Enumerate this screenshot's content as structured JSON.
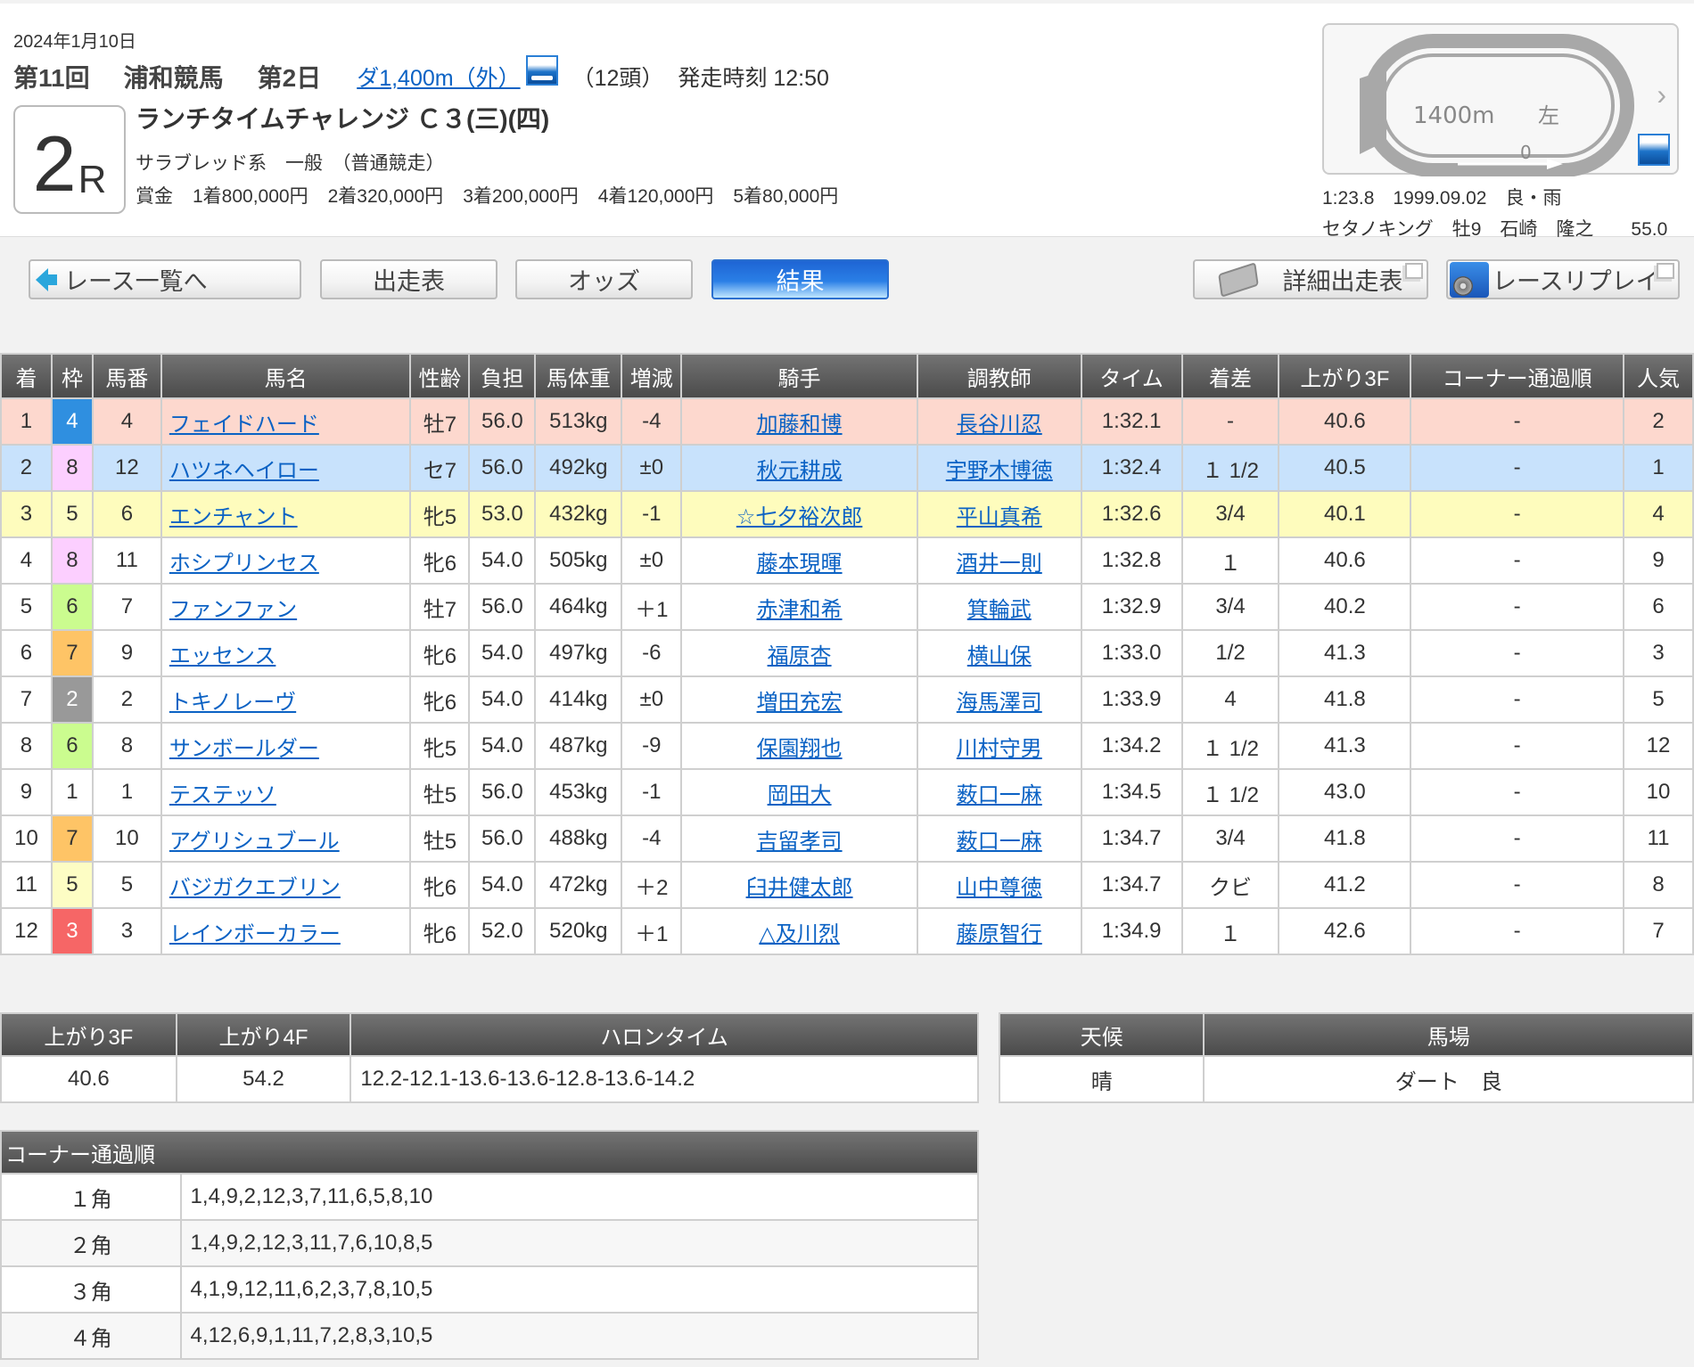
{
  "header": {
    "date": "2024年1月10日",
    "meeting": "第11回",
    "venue": "浦和競馬",
    "day": "第2日",
    "course_link": "ダ1,400m（外）",
    "runners": "（12頭）",
    "post_time": "発走時刻 12:50",
    "race_number": "2",
    "race_suffix": "R",
    "race_name": "ランチタイムチャレンジ Ｃ３(三)(四)",
    "conditions": "サラブレッド系　一般　（普通競走）",
    "prize_label": "賞金",
    "prizes": [
      "1着800,000円",
      "2着320,000円",
      "3着200,000円",
      "4着120,000円",
      "5着80,000円"
    ]
  },
  "course_map": {
    "distance_label": "1400m",
    "direction": "左",
    "start_marker": "0",
    "record_line1": "1:23.8　1999.09.02　良・雨",
    "record_line2": "セタノキング　牡9　石崎　隆之　　55.0"
  },
  "nav": {
    "back": "レース一覧へ",
    "entries": "出走表",
    "odds": "オッズ",
    "results": "結果",
    "detail_entries": "詳細出走表",
    "replay": "レースリプレイ"
  },
  "results": {
    "headers": [
      "着",
      "枠",
      "馬番",
      "馬名",
      "性齢",
      "負担",
      "馬体重",
      "増減",
      "騎手",
      "調教師",
      "タイム",
      "着差",
      "上がり3F",
      "コーナー通過順",
      "人気"
    ],
    "frame_colors": {
      "1": {
        "bg": "#ffffff",
        "fg": "#333333"
      },
      "2": {
        "bg": "#999999",
        "fg": "#ffffff"
      },
      "3": {
        "bg": "#f66666",
        "fg": "#ffffff"
      },
      "4": {
        "bg": "#2f8fe0",
        "fg": "#ffffff"
      },
      "5": {
        "bg": "#fdfdc4",
        "fg": "#333333"
      },
      "6": {
        "bg": "#cbfc8f",
        "fg": "#333333"
      },
      "7": {
        "bg": "#fec466",
        "fg": "#333333"
      },
      "8": {
        "bg": "#fccfff",
        "fg": "#333333"
      }
    },
    "rows": [
      {
        "pos": "1",
        "frame": "4",
        "num": "4",
        "horse": "フェイドハード",
        "sexage": "牡7",
        "weight": "56.0",
        "body": "513kg",
        "diff": "-4",
        "jockey": "加藤和博",
        "trainer": "長谷川忍",
        "time": "1:32.1",
        "margin": "-",
        "last3f": "40.6",
        "corner": "-",
        "pop": "2"
      },
      {
        "pos": "2",
        "frame": "8",
        "num": "12",
        "horse": "ハツネヘイロー",
        "sexage": "セ7",
        "weight": "56.0",
        "body": "492kg",
        "diff": "±0",
        "jockey": "秋元耕成",
        "trainer": "宇野木博徳",
        "time": "1:32.4",
        "margin": "１ 1/2",
        "last3f": "40.5",
        "corner": "-",
        "pop": "1"
      },
      {
        "pos": "3",
        "frame": "5",
        "num": "6",
        "horse": "エンチャント",
        "sexage": "牝5",
        "weight": "53.0",
        "body": "432kg",
        "diff": "-1",
        "jockey": "☆七夕裕次郎",
        "trainer": "平山真希",
        "time": "1:32.6",
        "margin": "3/4",
        "last3f": "40.1",
        "corner": "-",
        "pop": "4"
      },
      {
        "pos": "4",
        "frame": "8",
        "num": "11",
        "horse": "ホシプリンセス",
        "sexage": "牝6",
        "weight": "54.0",
        "body": "505kg",
        "diff": "±0",
        "jockey": "藤本現暉",
        "trainer": "酒井一則",
        "time": "1:32.8",
        "margin": "１",
        "last3f": "40.6",
        "corner": "-",
        "pop": "9"
      },
      {
        "pos": "5",
        "frame": "6",
        "num": "7",
        "horse": "ファンファン",
        "sexage": "牡7",
        "weight": "56.0",
        "body": "464kg",
        "diff": "＋1",
        "jockey": "赤津和希",
        "trainer": "箕輪武",
        "time": "1:32.9",
        "margin": "3/4",
        "last3f": "40.2",
        "corner": "-",
        "pop": "6"
      },
      {
        "pos": "6",
        "frame": "7",
        "num": "9",
        "horse": "エッセンス",
        "sexage": "牝6",
        "weight": "54.0",
        "body": "497kg",
        "diff": "-6",
        "jockey": "福原杏",
        "trainer": "横山保",
        "time": "1:33.0",
        "margin": "1/2",
        "last3f": "41.3",
        "corner": "-",
        "pop": "3"
      },
      {
        "pos": "7",
        "frame": "2",
        "num": "2",
        "horse": "トキノレーヴ",
        "sexage": "牝6",
        "weight": "54.0",
        "body": "414kg",
        "diff": "±0",
        "jockey": "増田充宏",
        "trainer": "海馬澤司",
        "time": "1:33.9",
        "margin": "4",
        "last3f": "41.8",
        "corner": "-",
        "pop": "5"
      },
      {
        "pos": "8",
        "frame": "6",
        "num": "8",
        "horse": "サンボールダー",
        "sexage": "牝5",
        "weight": "54.0",
        "body": "487kg",
        "diff": "-9",
        "jockey": "保園翔也",
        "trainer": "川村守男",
        "time": "1:34.2",
        "margin": "１ 1/2",
        "last3f": "41.3",
        "corner": "-",
        "pop": "12"
      },
      {
        "pos": "9",
        "frame": "1",
        "num": "1",
        "horse": "テステッソ",
        "sexage": "牡5",
        "weight": "56.0",
        "body": "453kg",
        "diff": "-1",
        "jockey": "岡田大",
        "trainer": "薮口一麻",
        "time": "1:34.5",
        "margin": "１ 1/2",
        "last3f": "43.0",
        "corner": "-",
        "pop": "10"
      },
      {
        "pos": "10",
        "frame": "7",
        "num": "10",
        "horse": "アグリシュブール",
        "sexage": "牡5",
        "weight": "56.0",
        "body": "488kg",
        "diff": "-4",
        "jockey": "吉留孝司",
        "trainer": "薮口一麻",
        "time": "1:34.7",
        "margin": "3/4",
        "last3f": "41.8",
        "corner": "-",
        "pop": "11"
      },
      {
        "pos": "11",
        "frame": "5",
        "num": "5",
        "horse": "バジガクエブリン",
        "sexage": "牝6",
        "weight": "54.0",
        "body": "472kg",
        "diff": "＋2",
        "jockey": "臼井健太郎",
        "trainer": "山中尊徳",
        "time": "1:34.7",
        "margin": "クビ",
        "last3f": "41.2",
        "corner": "-",
        "pop": "8"
      },
      {
        "pos": "12",
        "frame": "3",
        "num": "3",
        "horse": "レインボーカラー",
        "sexage": "牝6",
        "weight": "52.0",
        "body": "520kg",
        "diff": "＋1",
        "jockey": "△及川烈",
        "trainer": "藤原智行",
        "time": "1:34.9",
        "margin": "１",
        "last3f": "42.6",
        "corner": "-",
        "pop": "7"
      }
    ]
  },
  "laps": {
    "headers": [
      "上がり3F",
      "上がり4F",
      "ハロンタイム"
    ],
    "last3f": "40.6",
    "last4f": "54.2",
    "furlongs": "12.2-12.1-13.6-13.6-12.8-13.6-14.2"
  },
  "weather": {
    "headers": [
      "天候",
      "馬場"
    ],
    "weather": "晴",
    "track": "ダート　良"
  },
  "corners": {
    "title": "コーナー通過順",
    "rows": [
      {
        "label": "１角",
        "order": "1,4,9,2,12,3,7,11,6,5,8,10"
      },
      {
        "label": "２角",
        "order": "1,4,9,2,12,3,11,7,6,10,8,5"
      },
      {
        "label": "３角",
        "order": "4,1,9,12,11,6,2,3,7,8,10,5"
      },
      {
        "label": "４角",
        "order": "4,12,6,9,1,11,7,2,8,3,10,5"
      }
    ]
  }
}
